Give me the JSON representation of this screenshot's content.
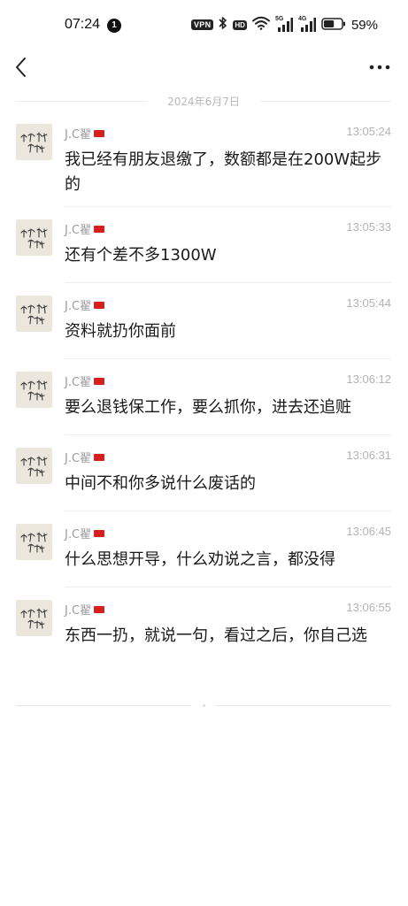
{
  "status_bar": {
    "time": "07:24",
    "notification_count": "1",
    "vpn_label": "VPN",
    "hd_label": "HD",
    "signal_1_label": "5G",
    "signal_2_label": "4G",
    "battery_percent": "59%",
    "battery_level": 0.59
  },
  "nav": {
    "back_icon": "chevron-left-icon",
    "more_icon": "more-horizontal-icon"
  },
  "date_separator": "2024年6月7日",
  "messages": [
    {
      "sender": "J.C翟",
      "time": "13:05:24",
      "text": "我已经有朋友退缴了，数额都是在200W起步的"
    },
    {
      "sender": "J.C翟",
      "time": "13:05:33",
      "text": "还有个差不多1300W"
    },
    {
      "sender": "J.C翟",
      "time": "13:05:44",
      "text": "资料就扔你面前"
    },
    {
      "sender": "J.C翟",
      "time": "13:06:12",
      "text": "要么退钱保工作，要么抓你，进去还追赃"
    },
    {
      "sender": "J.C翟",
      "time": "13:06:31",
      "text": "中间不和你多说什么废话的"
    },
    {
      "sender": "J.C翟",
      "time": "13:06:45",
      "text": "什么思想开导，什么劝说之言，都没得"
    },
    {
      "sender": "J.C翟",
      "time": "13:06:55",
      "text": "东西一扔，就说一句，看过之后，你自己选"
    }
  ],
  "colors": {
    "flag": "#d62020",
    "avatar_bg": "#ece7dd",
    "meta_text": "#9a9a9a"
  }
}
